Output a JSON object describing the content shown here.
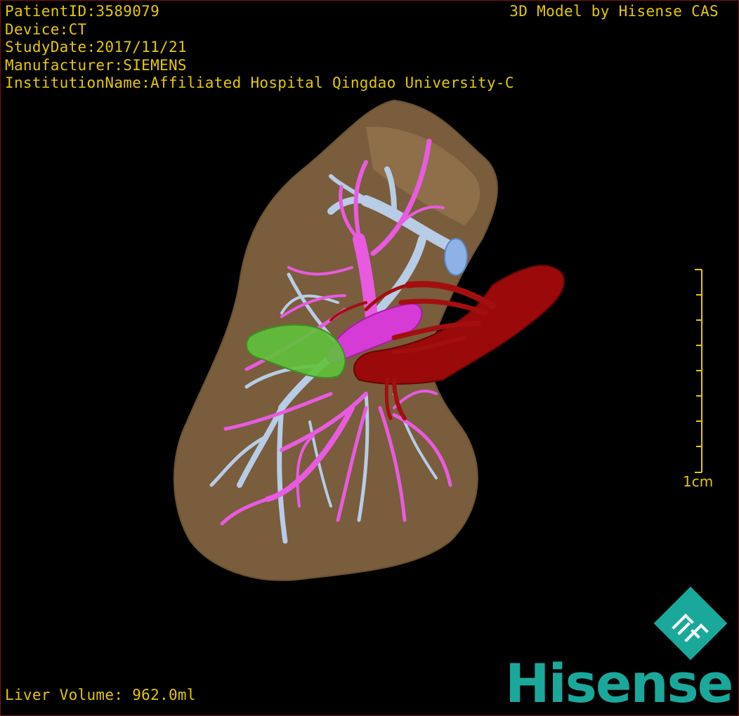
{
  "overlay": {
    "patient_id": "PatientID:3589079",
    "device": "Device:CT",
    "study_date": "StudyDate:2017/11/21",
    "manufacturer": "Manufacturer:SIEMENS",
    "institution": "InstitutionName:Affiliated Hospital Qingdao University-C",
    "credit": "3D Model by Hisense CAS",
    "liver_volume": "Liver Volume:  962.0ml"
  },
  "scale_bar": {
    "label": "1cm"
  },
  "brand": {
    "name": "Hisense",
    "logo_icon": "hisense-cas-diamond-logo"
  },
  "colors": {
    "overlay_text": "#e6c800",
    "liver": "#8a6a45",
    "portal_vein": "#e85be0",
    "hepatic_vein": "#b8cce6",
    "artery": "#9a0a0a",
    "tumor": "#5fc23a",
    "brand": "#1aa89b"
  }
}
